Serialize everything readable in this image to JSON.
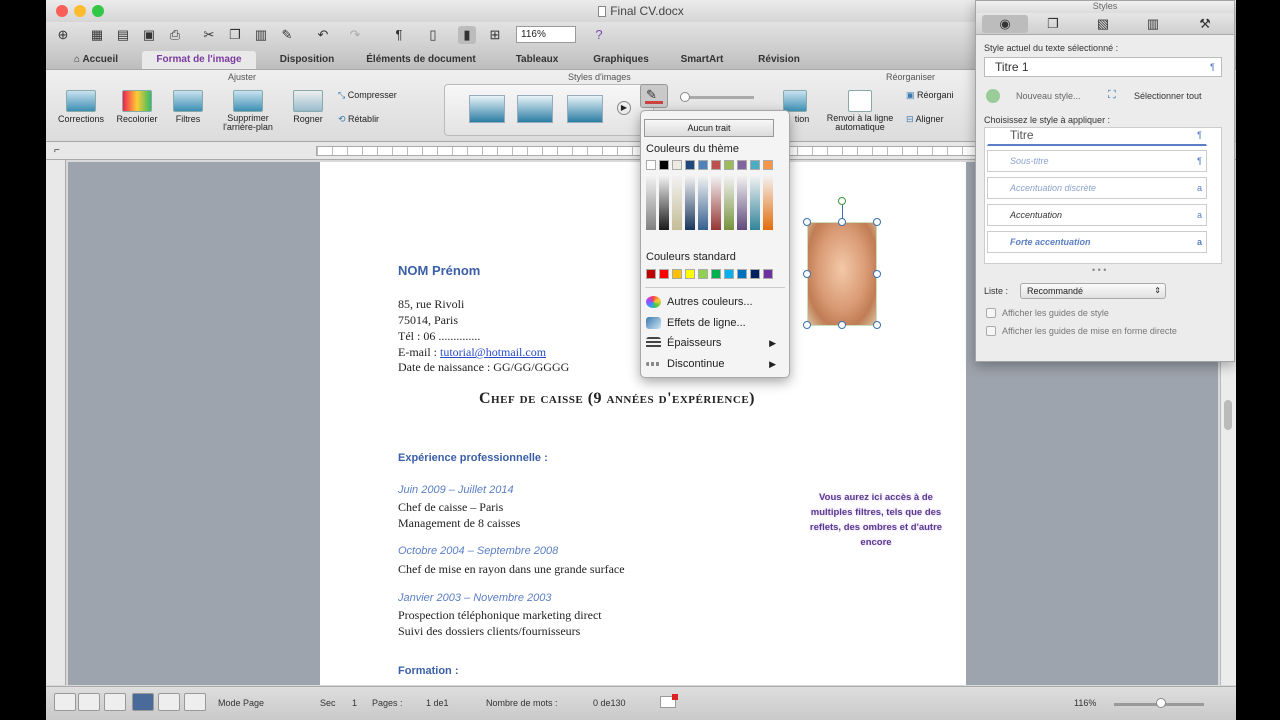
{
  "window": {
    "title": "Final CV.docx"
  },
  "toolbar": {
    "zoom": "116%"
  },
  "ribbon_tabs": [
    {
      "label": "Accueil"
    },
    {
      "label": "Format de l'image"
    },
    {
      "label": "Disposition"
    },
    {
      "label": "Éléments de document"
    },
    {
      "label": "Tableaux"
    },
    {
      "label": "Graphiques"
    },
    {
      "label": "SmartArt"
    },
    {
      "label": "Révision"
    }
  ],
  "ribbon": {
    "groups": {
      "ajuster": "Ajuster",
      "styles": "Styles d'images",
      "reorganiser": "Réorganiser"
    },
    "buttons": {
      "corrections": "Corrections",
      "recolorier": "Recolorier",
      "filtres": "Filtres",
      "supprimer": "Supprimer l'arrière-plan",
      "rogner": "Rogner",
      "compresser": "Compresser",
      "retablir": "Rétablir",
      "position": "tion",
      "renvoi": "Renvoi à la ligne automatique",
      "reorganiser": "Réorgani",
      "aligner": "Aligner"
    }
  },
  "popup": {
    "no_line": "Aucun trait",
    "theme_colors": "Couleurs du thème",
    "standard_colors": "Couleurs standard",
    "theme_top": [
      "#ffffff",
      "#000000",
      "#eeece1",
      "#1f497d",
      "#4f81bd",
      "#c0504d",
      "#9bbb59",
      "#8064a2",
      "#4bacc6",
      "#f79646"
    ],
    "theme_cols": [
      "#808080",
      "#1a1a1a",
      "#c4bd97",
      "#17365d",
      "#366092",
      "#953734",
      "#76923c",
      "#5f497a",
      "#31859b",
      "#e36c09"
    ],
    "standard": [
      "#c00000",
      "#ff0000",
      "#ffc000",
      "#ffff00",
      "#92d050",
      "#00b050",
      "#00b0f0",
      "#0070c0",
      "#002060",
      "#7030a0"
    ],
    "items": [
      {
        "label": "Autres couleurs..."
      },
      {
        "label": "Effets de ligne..."
      },
      {
        "label": "Épaisseurs"
      },
      {
        "label": "Discontinue"
      }
    ]
  },
  "document": {
    "name": "NOM Prénom",
    "address1": "85, rue Rivoli",
    "address2": "75014, Paris",
    "phone": "Tél : 06 ..............",
    "email_label": "E-mail : ",
    "email": "tutorial@hotmail.com",
    "birth": "Date de naissance : GG/GG/GGGG",
    "heading": "Chef de caisse (9 années d'expérience)",
    "section_exp": "Expérience professionnelle :",
    "job1_date": "Juin 2009 – Juillet 2014",
    "job1_title": "Chef de caisse – Paris",
    "job1_desc": "Management de 8 caisses",
    "job2_date": "Octobre 2004 – Septembre 2008",
    "job2_desc": "Chef de mise en rayon dans une grande surface",
    "job3_date": "Janvier 2003 – Novembre 2003",
    "job3_desc1": "Prospection téléphonique marketing direct",
    "job3_desc2": "Suivi des dossiers clients/fournisseurs",
    "section_formation": "Formation :",
    "callout": "Vous aurez ici accès à de multiples filtres, tels que des reflets, des ombres et d'autre encore"
  },
  "styles_panel": {
    "title": "Styles",
    "current_label": "Style actuel du texte sélectionné :",
    "current_value": "Titre 1",
    "new_style": "Nouveau style...",
    "select_all": "Sélectionner tout",
    "choose_label": "Choisissez le style à appliquer :",
    "styles": [
      {
        "label": "Titre"
      },
      {
        "label": "Sous-titre"
      },
      {
        "label": "Accentuation discrète"
      },
      {
        "label": "Accentuation"
      },
      {
        "label": "Forte accentuation"
      }
    ],
    "list_label": "Liste :",
    "list_value": "Recommandé",
    "check1": "Afficher les guides de style",
    "check2": "Afficher les guides de mise en forme directe"
  },
  "status": {
    "mode": "Mode Page",
    "sec_label": "Sec",
    "sec_value": "1",
    "pages_label": "Pages :",
    "pages_value": "1 de1",
    "words_label": "Nombre de mots :",
    "words_value": "0 de130",
    "zoom": "116%"
  }
}
